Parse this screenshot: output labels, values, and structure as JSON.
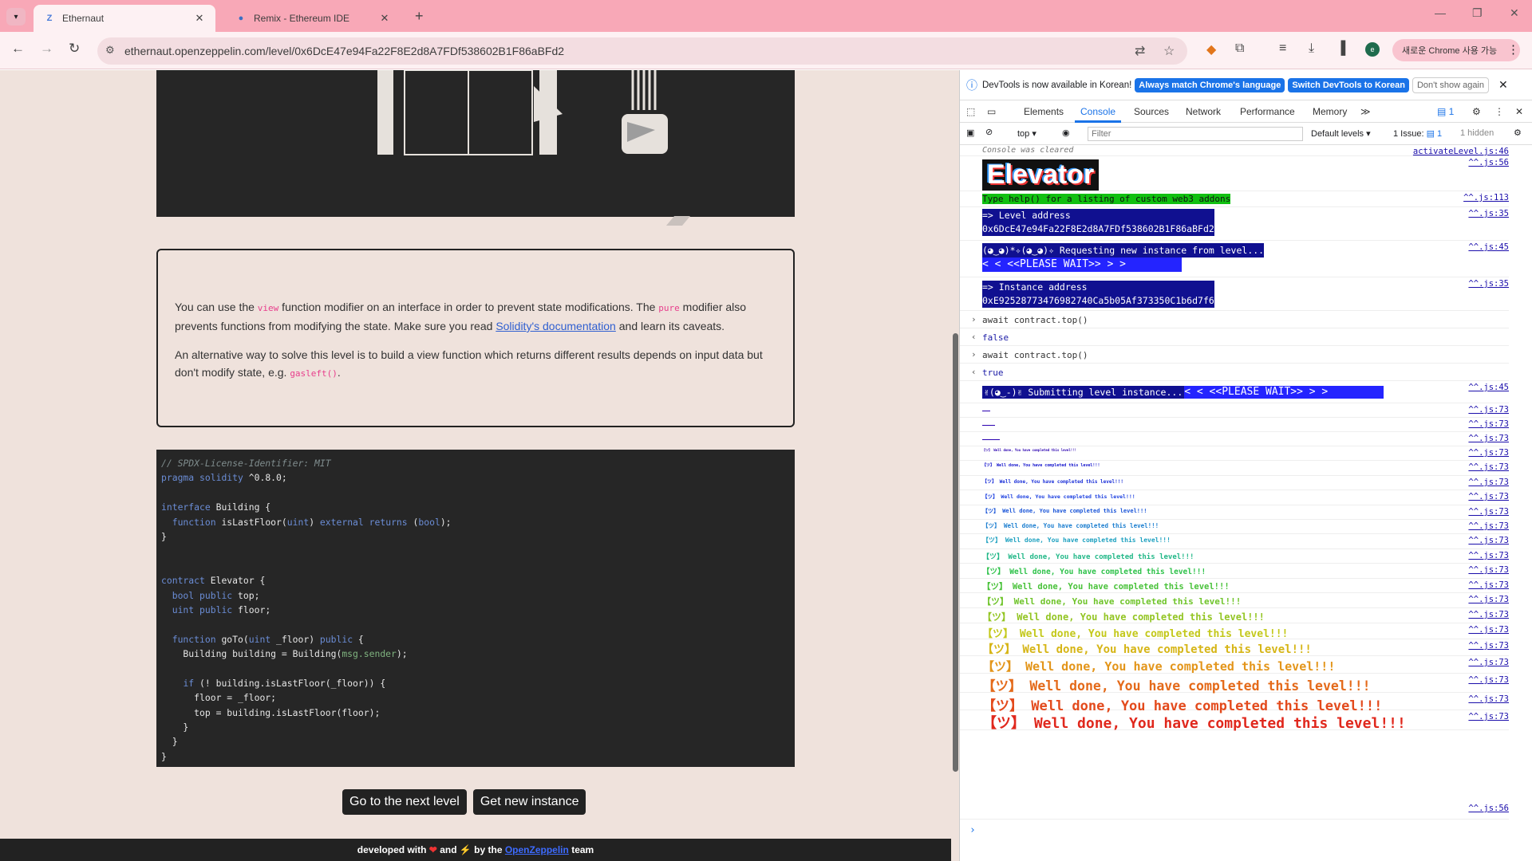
{
  "tabs": [
    {
      "title": "Ethernaut",
      "favicon": "Z",
      "active": true
    },
    {
      "title": "Remix - Ethereum IDE",
      "favicon": "●",
      "active": false
    }
  ],
  "address_bar": {
    "url": "ethernaut.openzeppelin.com/level/0x6DcE47e94Fa22F8E2d8A7FDf538602B1F86aBFd2"
  },
  "browser": {
    "update_label": "새로운 Chrome 사용 가능",
    "profile_initial": "e"
  },
  "description": {
    "p1_a": "You can use the ",
    "p1_code1": "view",
    "p1_b": " function modifier on an interface in order to prevent state modifications. The ",
    "p1_code2": "pure",
    "p1_c": " modifier also prevents functions from modifying the state. Make sure you read ",
    "p1_link": "Solidity's documentation",
    "p1_d": " and learn its caveats.",
    "p2_a": "An alternative way to solve this level is to build a view function which returns different results depends on input data but don't modify state, e.g. ",
    "p2_code": "gasleft()",
    "p2_b": "."
  },
  "code": {
    "lines": [
      "// SPDX-License-Identifier: MIT",
      "pragma solidity ^0.8.0;",
      "",
      "interface Building {",
      "  function isLastFloor(uint) external returns (bool);",
      "}",
      "",
      "",
      "contract Elevator {",
      "  bool public top;",
      "  uint public floor;",
      "",
      "  function goTo(uint _floor) public {",
      "    Building building = Building(msg.sender);",
      "",
      "    if (! building.isLastFloor(_floor)) {",
      "      floor = _floor;",
      "      top = building.isLastFloor(floor);",
      "    }",
      "  }",
      "}"
    ]
  },
  "buttons": {
    "next_level": "Go to the next level",
    "new_instance": "Get new instance"
  },
  "footer": {
    "a": "developed with ",
    "b": " and ",
    "c": " by the ",
    "link": "OpenZeppelin",
    "d": " team"
  },
  "devtools": {
    "info": "DevTools is now available in Korean!",
    "btn_match": "Always match Chrome's language",
    "btn_switch": "Switch DevTools to Korean",
    "btn_dont": "Don't show again",
    "tabs": [
      "Elements",
      "Console",
      "Sources",
      "Network",
      "Performance",
      "Memory"
    ],
    "active_tab": "Console",
    "filter_placeholder": "Filter",
    "context": "top",
    "levels": "Default levels",
    "issues": "1 Issue:",
    "issues_count": "1",
    "hidden": "1 hidden",
    "badge": "1",
    "console": {
      "cleared": "Console was cleared",
      "cleared_src": "activateLevel.js:46",
      "elevator": "Elevator",
      "src56": "^^.js:56",
      "help": "Type help() for a listing of custom web3 addons",
      "src113": "^^.js:113",
      "level_addr_label": "=> Level address",
      "level_addr": "0x6DcE47e94Fa22F8E2d8A7FDf538602B1F86aBFd2",
      "src35": "^^.js:35",
      "requesting": "(◕‿◕)*✧(◕‿◕)✧ Requesting new instance from level...",
      "please_wait": "<  < <<PLEASE WAIT>> >  >",
      "src45": "^^.js:45",
      "inst_addr_label": "=> Instance address",
      "inst_addr": "0xE92528773476982740Ca5b05Af373350C1b6d7f6",
      "cmd1": "await contract.top()",
      "res1": "false",
      "cmd2": "await contract.top()",
      "res2": "true",
      "submitting": "✌(◕‿-)✌ Submitting level instance...",
      "src73": "^^.js:73",
      "done": "【ツ】 Well done, You have completed this level!!!"
    }
  }
}
